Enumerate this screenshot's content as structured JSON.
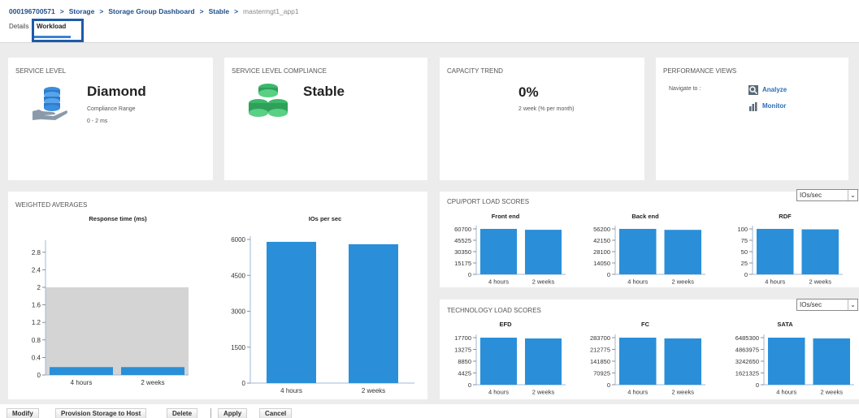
{
  "breadcrumb": {
    "items": [
      "000196700571",
      "Storage",
      "Storage Group Dashboard",
      "Stable"
    ],
    "current": "mastermgt1_app1",
    "separator": ">"
  },
  "tabs": {
    "details": "Details",
    "workload": "Workload"
  },
  "service_level": {
    "title": "SERVICE LEVEL",
    "value": "Diamond",
    "range_label": "Compliance Range",
    "range_value": "0 - 2 ms",
    "icon": "database-hand-icon"
  },
  "compliance": {
    "title": "SERVICE LEVEL COMPLIANCE",
    "value": "Stable",
    "icon": "green-database-stack-icon"
  },
  "capacity": {
    "title": "CAPACITY TREND",
    "value": "0%",
    "caption": "2 week (% per month)"
  },
  "performance": {
    "title": "PERFORMANCE VIEWS",
    "navigate_label": "Navigate to :",
    "analyze": "Analyze",
    "monitor": "Monitor"
  },
  "weighted": {
    "title": "WEIGHTED AVERAGES"
  },
  "cpu": {
    "title": "CPU/PORT LOAD SCORES",
    "select": "IOs/sec"
  },
  "tech": {
    "title": "TECHNOLOGY LOAD SCORES",
    "select": "IOs/sec"
  },
  "buttons": {
    "modify": "Modify",
    "provision": "Provision Storage to Host",
    "delete": "Delete",
    "apply": "Apply",
    "cancel": "Cancel"
  },
  "colors": {
    "bar": "#2a8fd8",
    "band": "#d4d4d4",
    "link": "#2a6fb5",
    "tab_highlight": "#1e5aa8",
    "diamond_icon": "#3a8ee0",
    "compliance_icon": "#3cb86a"
  },
  "chart_data": [
    {
      "type": "bar",
      "title": "Response time (ms)",
      "categories": [
        "4 hours",
        "2 weeks"
      ],
      "values": [
        0.18,
        0.18
      ],
      "yticks": [
        "0",
        "0.4",
        "0.8",
        "1.2",
        "1.6",
        "2",
        "2.4",
        "2.8"
      ],
      "ylim": [
        0,
        3.0
      ],
      "band": [
        0,
        2
      ],
      "grid": false
    },
    {
      "type": "bar",
      "title": "IOs per sec",
      "categories": [
        "4 hours",
        "2 weeks"
      ],
      "values": [
        5900,
        5800
      ],
      "yticks": [
        "0",
        "1500",
        "3000",
        "4500",
        "6000"
      ],
      "ylim": [
        0,
        6000
      ],
      "grid": false
    },
    {
      "type": "bar",
      "title": "Front end",
      "categories": [
        "4 hours",
        "2 weeks"
      ],
      "values": [
        60700,
        59500
      ],
      "yticks": [
        "0",
        "15175",
        "30350",
        "45525",
        "60700"
      ],
      "ylim": [
        0,
        60700
      ],
      "grid": false
    },
    {
      "type": "bar",
      "title": "Back end",
      "categories": [
        "4 hours",
        "2 weeks"
      ],
      "values": [
        56200,
        55000
      ],
      "yticks": [
        "0",
        "14050",
        "28100",
        "42150",
        "56200"
      ],
      "ylim": [
        0,
        56200
      ],
      "grid": false
    },
    {
      "type": "bar",
      "title": "RDF",
      "categories": [
        "4 hours",
        "2 weeks"
      ],
      "values": [
        100,
        99
      ],
      "yticks": [
        "0",
        "25",
        "50",
        "75",
        "100"
      ],
      "ylim": [
        0,
        100
      ],
      "grid": false
    },
    {
      "type": "bar",
      "title": "EFD",
      "categories": [
        "4 hours",
        "2 weeks"
      ],
      "values": [
        17700,
        17400
      ],
      "yticks": [
        "0",
        "4425",
        "8850",
        "13275",
        "17700"
      ],
      "ylim": [
        0,
        17700
      ],
      "grid": false
    },
    {
      "type": "bar",
      "title": "FC",
      "categories": [
        "4 hours",
        "2 weeks"
      ],
      "values": [
        283700,
        279000
      ],
      "yticks": [
        "0",
        "70925",
        "141850",
        "212775",
        "283700"
      ],
      "ylim": [
        0,
        283700
      ],
      "grid": false
    },
    {
      "type": "bar",
      "title": "SATA",
      "categories": [
        "4 hours",
        "2 weeks"
      ],
      "values": [
        6485300,
        6380000
      ],
      "yticks": [
        "0",
        "1621325",
        "3242650",
        "4863975",
        "6485300"
      ],
      "ylim": [
        0,
        6485300
      ],
      "grid": false
    }
  ]
}
